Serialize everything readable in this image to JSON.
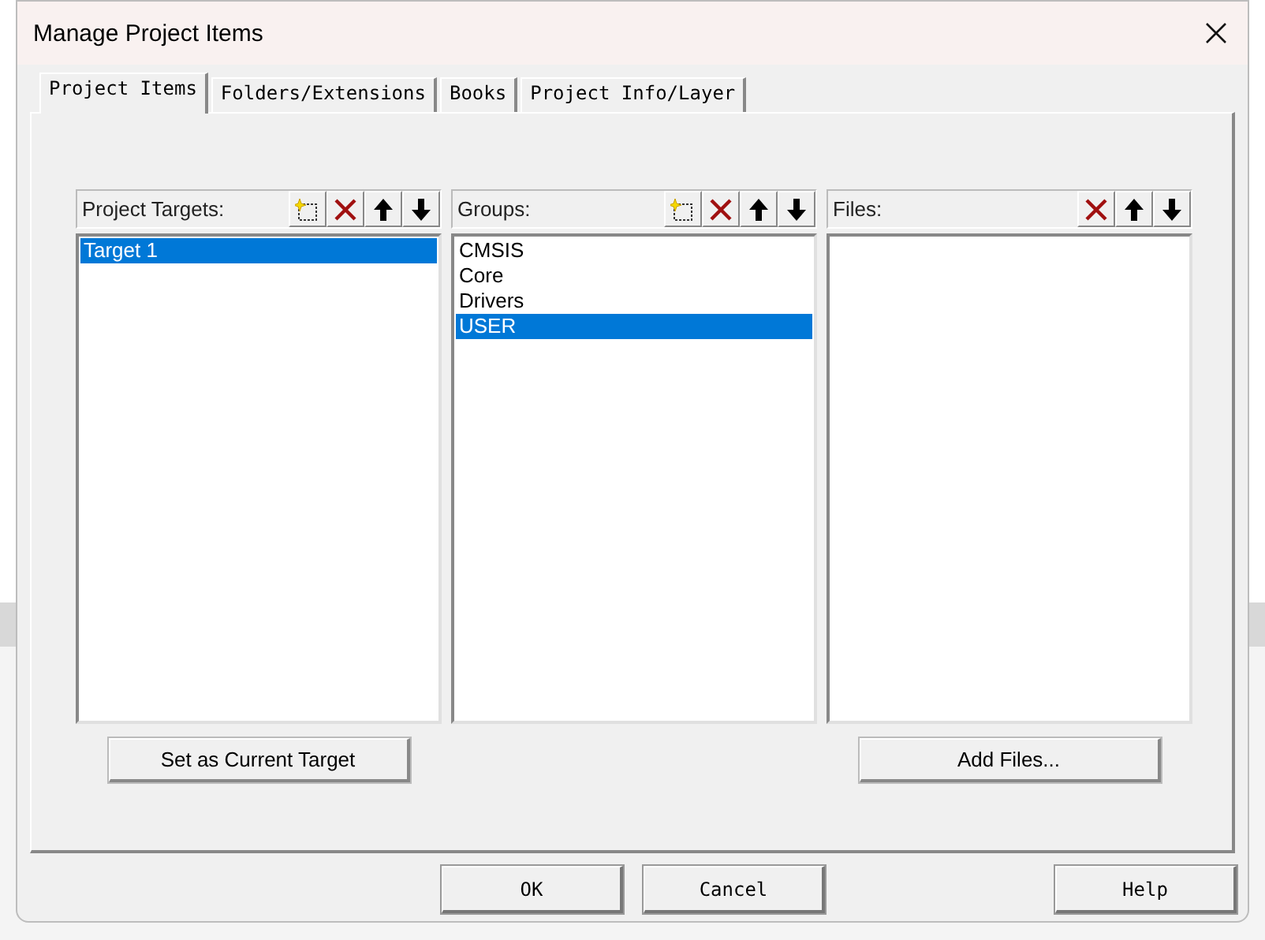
{
  "window": {
    "title": "Manage Project Items"
  },
  "tabs": [
    {
      "label": "Project Items",
      "selected": true
    },
    {
      "label": "Folders/Extensions",
      "selected": false
    },
    {
      "label": "Books",
      "selected": false
    },
    {
      "label": "Project Info/Layer",
      "selected": false
    }
  ],
  "panels": [
    {
      "label": "Project Targets:",
      "tools": [
        {
          "kind": "new"
        },
        {
          "kind": "delete"
        },
        {
          "kind": "up"
        },
        {
          "kind": "down"
        }
      ],
      "items": [
        {
          "label": "Target 1",
          "selected": true
        }
      ],
      "button": "Set as Current Target"
    },
    {
      "label": "Groups:",
      "tools": [
        {
          "kind": "new"
        },
        {
          "kind": "delete"
        },
        {
          "kind": "up"
        },
        {
          "kind": "down"
        }
      ],
      "items": [
        {
          "label": "CMSIS",
          "selected": false
        },
        {
          "label": "Core",
          "selected": false
        },
        {
          "label": "Drivers",
          "selected": false
        },
        {
          "label": "USER",
          "selected": true
        }
      ]
    },
    {
      "label": "Files:",
      "tools": [
        {
          "kind": "delete"
        },
        {
          "kind": "up"
        },
        {
          "kind": "down"
        }
      ],
      "button": "Add Files..."
    }
  ],
  "buttons": [
    "OK",
    "Cancel",
    "Help"
  ]
}
